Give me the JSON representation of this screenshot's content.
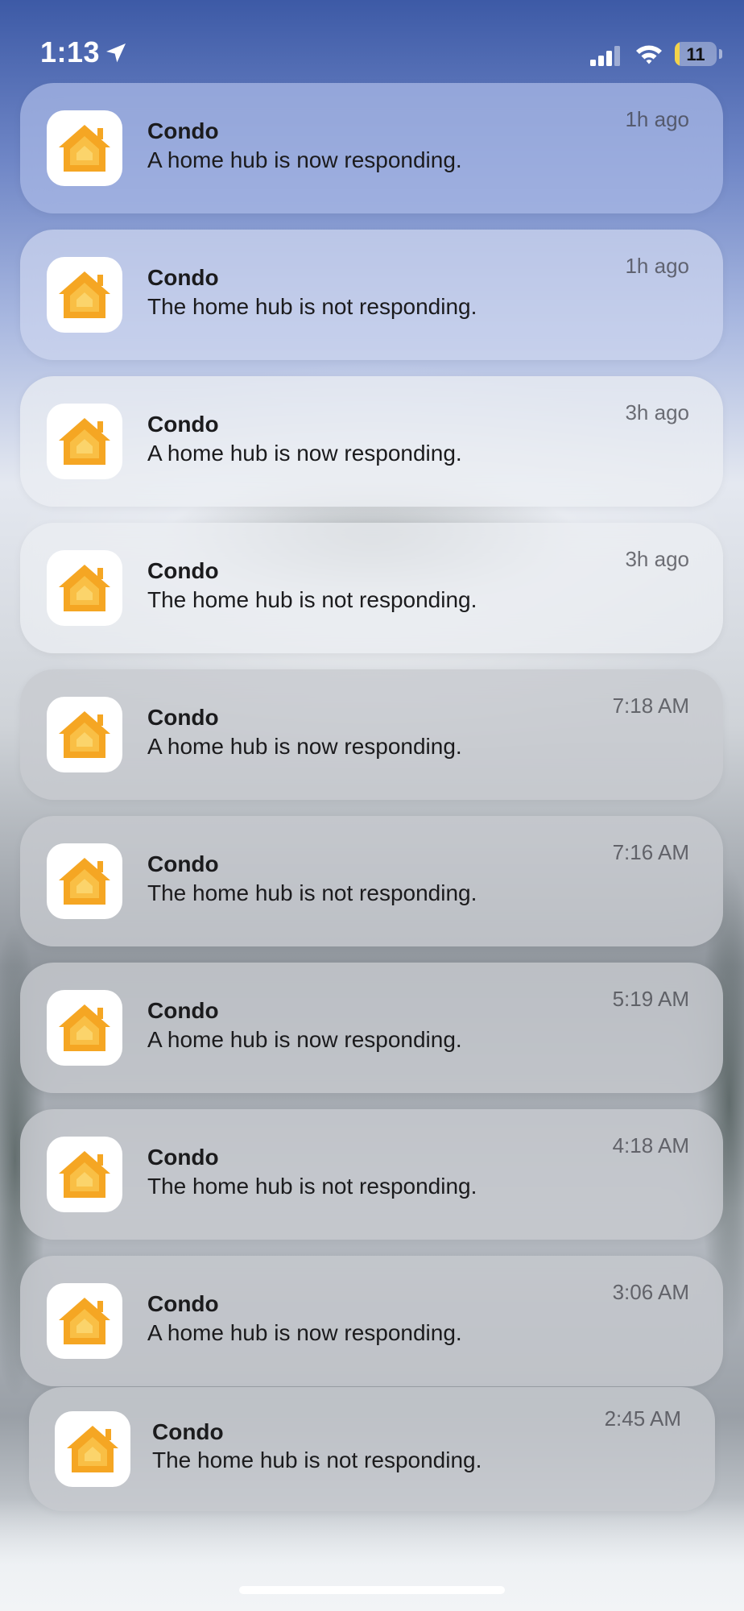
{
  "status_bar": {
    "time": "1:13",
    "battery_level": "11",
    "battery_fraction": 0.11,
    "battery_color": "#f3d34a",
    "icons": [
      "location-arrow-icon",
      "cellular-signal-icon",
      "wifi-icon",
      "battery-icon"
    ]
  },
  "notifications": [
    {
      "app_icon": "home-app-icon",
      "title": "Condo",
      "body": "A home hub is now responding.",
      "time": "1h ago"
    },
    {
      "app_icon": "home-app-icon",
      "title": "Condo",
      "body": "The home hub is not responding.",
      "time": "1h ago"
    },
    {
      "app_icon": "home-app-icon",
      "title": "Condo",
      "body": "A home hub is now responding.",
      "time": "3h ago"
    },
    {
      "app_icon": "home-app-icon",
      "title": "Condo",
      "body": "The home hub is not responding.",
      "time": "3h ago"
    },
    {
      "app_icon": "home-app-icon",
      "title": "Condo",
      "body": "A home hub is now responding.",
      "time": "7:18 AM"
    },
    {
      "app_icon": "home-app-icon",
      "title": "Condo",
      "body": "The home hub is not responding.",
      "time": "7:16 AM"
    },
    {
      "app_icon": "home-app-icon",
      "title": "Condo",
      "body": "A home hub is now responding.",
      "time": "5:19 AM"
    },
    {
      "app_icon": "home-app-icon",
      "title": "Condo",
      "body": "The home hub is not responding.",
      "time": "4:18 AM"
    },
    {
      "app_icon": "home-app-icon",
      "title": "Condo",
      "body": "A home hub is now responding.",
      "time": "3:06 AM"
    },
    {
      "app_icon": "home-app-icon",
      "title": "Condo",
      "body": "The home hub is not responding.",
      "time": "2:45 AM"
    }
  ],
  "colors": {
    "home_icon_orange": "#f5a623",
    "home_icon_light": "#fbd46b"
  }
}
